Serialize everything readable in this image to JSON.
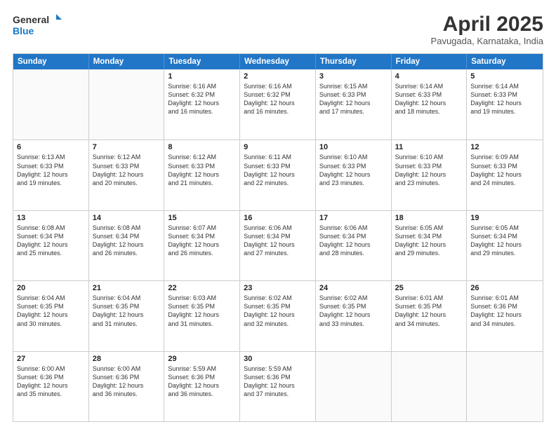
{
  "logo": {
    "line1": "General",
    "line2": "Blue"
  },
  "header": {
    "title": "April 2025",
    "subtitle": "Pavugada, Karnataka, India"
  },
  "days_of_week": [
    "Sunday",
    "Monday",
    "Tuesday",
    "Wednesday",
    "Thursday",
    "Friday",
    "Saturday"
  ],
  "weeks": [
    [
      {
        "day": "",
        "lines": []
      },
      {
        "day": "",
        "lines": []
      },
      {
        "day": "1",
        "lines": [
          "Sunrise: 6:16 AM",
          "Sunset: 6:32 PM",
          "Daylight: 12 hours",
          "and 16 minutes."
        ]
      },
      {
        "day": "2",
        "lines": [
          "Sunrise: 6:16 AM",
          "Sunset: 6:32 PM",
          "Daylight: 12 hours",
          "and 16 minutes."
        ]
      },
      {
        "day": "3",
        "lines": [
          "Sunrise: 6:15 AM",
          "Sunset: 6:33 PM",
          "Daylight: 12 hours",
          "and 17 minutes."
        ]
      },
      {
        "day": "4",
        "lines": [
          "Sunrise: 6:14 AM",
          "Sunset: 6:33 PM",
          "Daylight: 12 hours",
          "and 18 minutes."
        ]
      },
      {
        "day": "5",
        "lines": [
          "Sunrise: 6:14 AM",
          "Sunset: 6:33 PM",
          "Daylight: 12 hours",
          "and 19 minutes."
        ]
      }
    ],
    [
      {
        "day": "6",
        "lines": [
          "Sunrise: 6:13 AM",
          "Sunset: 6:33 PM",
          "Daylight: 12 hours",
          "and 19 minutes."
        ]
      },
      {
        "day": "7",
        "lines": [
          "Sunrise: 6:12 AM",
          "Sunset: 6:33 PM",
          "Daylight: 12 hours",
          "and 20 minutes."
        ]
      },
      {
        "day": "8",
        "lines": [
          "Sunrise: 6:12 AM",
          "Sunset: 6:33 PM",
          "Daylight: 12 hours",
          "and 21 minutes."
        ]
      },
      {
        "day": "9",
        "lines": [
          "Sunrise: 6:11 AM",
          "Sunset: 6:33 PM",
          "Daylight: 12 hours",
          "and 22 minutes."
        ]
      },
      {
        "day": "10",
        "lines": [
          "Sunrise: 6:10 AM",
          "Sunset: 6:33 PM",
          "Daylight: 12 hours",
          "and 23 minutes."
        ]
      },
      {
        "day": "11",
        "lines": [
          "Sunrise: 6:10 AM",
          "Sunset: 6:33 PM",
          "Daylight: 12 hours",
          "and 23 minutes."
        ]
      },
      {
        "day": "12",
        "lines": [
          "Sunrise: 6:09 AM",
          "Sunset: 6:33 PM",
          "Daylight: 12 hours",
          "and 24 minutes."
        ]
      }
    ],
    [
      {
        "day": "13",
        "lines": [
          "Sunrise: 6:08 AM",
          "Sunset: 6:34 PM",
          "Daylight: 12 hours",
          "and 25 minutes."
        ]
      },
      {
        "day": "14",
        "lines": [
          "Sunrise: 6:08 AM",
          "Sunset: 6:34 PM",
          "Daylight: 12 hours",
          "and 26 minutes."
        ]
      },
      {
        "day": "15",
        "lines": [
          "Sunrise: 6:07 AM",
          "Sunset: 6:34 PM",
          "Daylight: 12 hours",
          "and 26 minutes."
        ]
      },
      {
        "day": "16",
        "lines": [
          "Sunrise: 6:06 AM",
          "Sunset: 6:34 PM",
          "Daylight: 12 hours",
          "and 27 minutes."
        ]
      },
      {
        "day": "17",
        "lines": [
          "Sunrise: 6:06 AM",
          "Sunset: 6:34 PM",
          "Daylight: 12 hours",
          "and 28 minutes."
        ]
      },
      {
        "day": "18",
        "lines": [
          "Sunrise: 6:05 AM",
          "Sunset: 6:34 PM",
          "Daylight: 12 hours",
          "and 29 minutes."
        ]
      },
      {
        "day": "19",
        "lines": [
          "Sunrise: 6:05 AM",
          "Sunset: 6:34 PM",
          "Daylight: 12 hours",
          "and 29 minutes."
        ]
      }
    ],
    [
      {
        "day": "20",
        "lines": [
          "Sunrise: 6:04 AM",
          "Sunset: 6:35 PM",
          "Daylight: 12 hours",
          "and 30 minutes."
        ]
      },
      {
        "day": "21",
        "lines": [
          "Sunrise: 6:04 AM",
          "Sunset: 6:35 PM",
          "Daylight: 12 hours",
          "and 31 minutes."
        ]
      },
      {
        "day": "22",
        "lines": [
          "Sunrise: 6:03 AM",
          "Sunset: 6:35 PM",
          "Daylight: 12 hours",
          "and 31 minutes."
        ]
      },
      {
        "day": "23",
        "lines": [
          "Sunrise: 6:02 AM",
          "Sunset: 6:35 PM",
          "Daylight: 12 hours",
          "and 32 minutes."
        ]
      },
      {
        "day": "24",
        "lines": [
          "Sunrise: 6:02 AM",
          "Sunset: 6:35 PM",
          "Daylight: 12 hours",
          "and 33 minutes."
        ]
      },
      {
        "day": "25",
        "lines": [
          "Sunrise: 6:01 AM",
          "Sunset: 6:35 PM",
          "Daylight: 12 hours",
          "and 34 minutes."
        ]
      },
      {
        "day": "26",
        "lines": [
          "Sunrise: 6:01 AM",
          "Sunset: 6:36 PM",
          "Daylight: 12 hours",
          "and 34 minutes."
        ]
      }
    ],
    [
      {
        "day": "27",
        "lines": [
          "Sunrise: 6:00 AM",
          "Sunset: 6:36 PM",
          "Daylight: 12 hours",
          "and 35 minutes."
        ]
      },
      {
        "day": "28",
        "lines": [
          "Sunrise: 6:00 AM",
          "Sunset: 6:36 PM",
          "Daylight: 12 hours",
          "and 36 minutes."
        ]
      },
      {
        "day": "29",
        "lines": [
          "Sunrise: 5:59 AM",
          "Sunset: 6:36 PM",
          "Daylight: 12 hours",
          "and 36 minutes."
        ]
      },
      {
        "day": "30",
        "lines": [
          "Sunrise: 5:59 AM",
          "Sunset: 6:36 PM",
          "Daylight: 12 hours",
          "and 37 minutes."
        ]
      },
      {
        "day": "",
        "lines": []
      },
      {
        "day": "",
        "lines": []
      },
      {
        "day": "",
        "lines": []
      }
    ]
  ]
}
